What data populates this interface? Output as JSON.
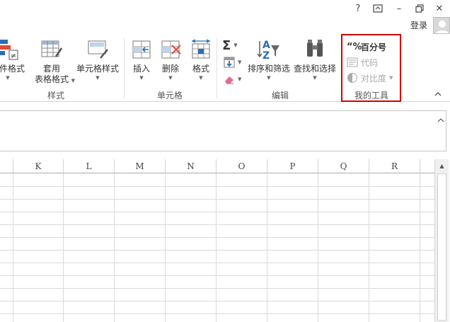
{
  "window": {
    "help_label": "?",
    "restore_ribbon_label": "⊡",
    "minimize_label": "–",
    "maximize_label": "❐",
    "close_label": "✕",
    "login_label": "登录"
  },
  "ribbon": {
    "styles_group": {
      "conditional_format_label": "条件格式",
      "table_format_label_line1": "套用",
      "table_format_label_line2": "表格格式",
      "cell_styles_label": "单元格样式",
      "group_label": "样式"
    },
    "cells_group": {
      "insert_label": "插入",
      "delete_label": "删除",
      "format_label": "格式",
      "group_label": "单元格"
    },
    "editing_group": {
      "sort_filter_label": "排序和筛选",
      "find_select_label": "查找和选择",
      "group_label": "编辑"
    },
    "mytools_group": {
      "percent_label": "百分号",
      "code_label": "代码",
      "contrast_label": "对比度",
      "group_label": "我的工具",
      "highlight_color": "#d40000"
    },
    "collapse_label": "^"
  },
  "grid": {
    "columns": [
      "K",
      "L",
      "M",
      "N",
      "O",
      "P",
      "Q",
      "R"
    ]
  },
  "scrollbar": {
    "up_arrow": "▲"
  }
}
